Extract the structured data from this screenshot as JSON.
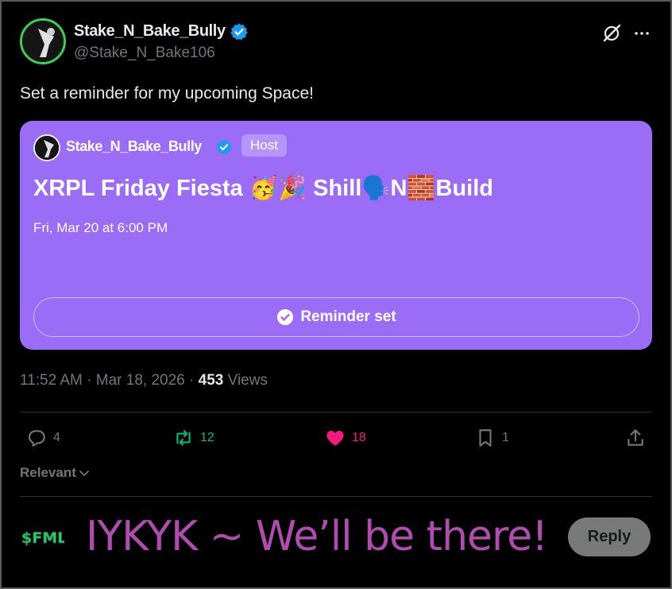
{
  "author": {
    "display_name": "Stake_N_Bake_Bully",
    "handle": "@Stake_N_Bake106"
  },
  "tweet": {
    "text": "Set a reminder for my upcoming Space!"
  },
  "space_card": {
    "host_name": "Stake_N_Bake_Bully",
    "host_badge": "Host",
    "title": "XRPL Friday Fiesta 🥳🎉 Shill🗣️N🧱Build",
    "date": "Fri, Mar 20 at 6:00 PM",
    "reminder_label": "Reminder set",
    "background_color": "#9b6cf5"
  },
  "meta": {
    "time": "11:52 AM",
    "date": "Mar 18, 2026",
    "views_count": "453",
    "views_label": "Views"
  },
  "actions": {
    "replies": "4",
    "retweets": "12",
    "likes": "18",
    "bookmarks": "1"
  },
  "sort": {
    "label": "Relevant"
  },
  "reply_bar": {
    "logo_text": "$FML",
    "overlay_text": "IYKYK ~ We’ll be there!",
    "reply_button": "Reply"
  },
  "colors": {
    "accent_like": "#f91880",
    "accent_retweet": "#00ba7c",
    "verified": "#1d9bf0",
    "overlay_text": "#b04cb0"
  },
  "icons": [
    "verified-icon",
    "grok-icon",
    "more-icon",
    "check-circle-icon",
    "reply-icon",
    "retweet-icon",
    "heart-icon",
    "bookmark-icon",
    "share-icon",
    "chevron-down-icon"
  ]
}
